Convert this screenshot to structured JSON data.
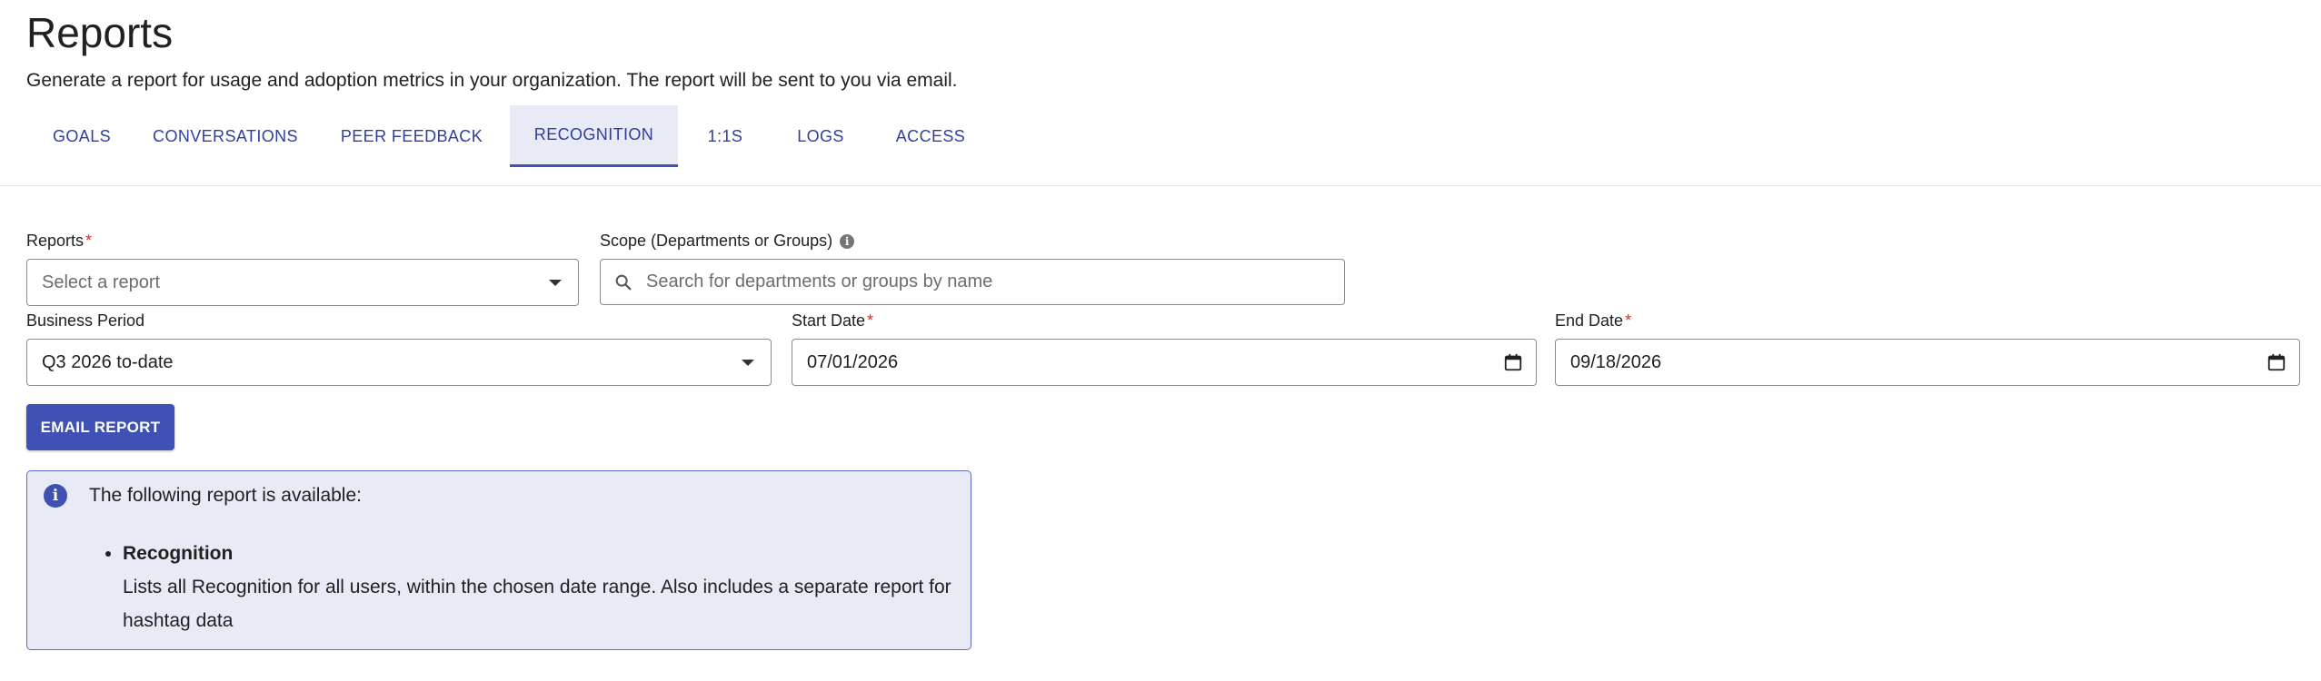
{
  "page": {
    "title": "Reports",
    "subtitle": "Generate a report for usage and adoption metrics in your organization. The report will be sent to you via email."
  },
  "tabs": [
    {
      "label": "GOALS"
    },
    {
      "label": "CONVERSATIONS"
    },
    {
      "label": "PEER FEEDBACK"
    },
    {
      "label": "RECOGNITION",
      "active": true
    },
    {
      "label": "1:1S"
    },
    {
      "label": "LOGS"
    },
    {
      "label": "ACCESS"
    }
  ],
  "form": {
    "reports": {
      "label": "Reports",
      "required_mark": "*",
      "placeholder": "Select a report"
    },
    "scope": {
      "label": "Scope (Departments or Groups)",
      "info_glyph": "i",
      "placeholder": "Search for departments or groups by name"
    },
    "business_period": {
      "label": "Business Period",
      "value": "Q3 2026 to-date"
    },
    "start_date": {
      "label": "Start Date",
      "required_mark": "*",
      "value": "07/01/2026"
    },
    "end_date": {
      "label": "End Date",
      "required_mark": "*",
      "value": "09/18/2026"
    },
    "email_button": "EMAIL REPORT"
  },
  "alert": {
    "icon_glyph": "i",
    "heading": "The following report is available:",
    "items": [
      {
        "title": "Recognition",
        "description": "Lists all Recognition for all users, within the chosen date range. Also includes a separate report for hashtag data"
      }
    ]
  },
  "colors": {
    "primary": "#3f51b5",
    "tab_text": "#303f9f",
    "tab_active_bg": "#e8eaf6",
    "required": "#d32f2f",
    "alert_bg": "#e8eaf6",
    "alert_border": "#5c6bc0"
  },
  "icons": {
    "search": "search-icon",
    "calendar": "calendar-icon",
    "dropdown": "chevron-down-icon",
    "info": "info-icon"
  }
}
